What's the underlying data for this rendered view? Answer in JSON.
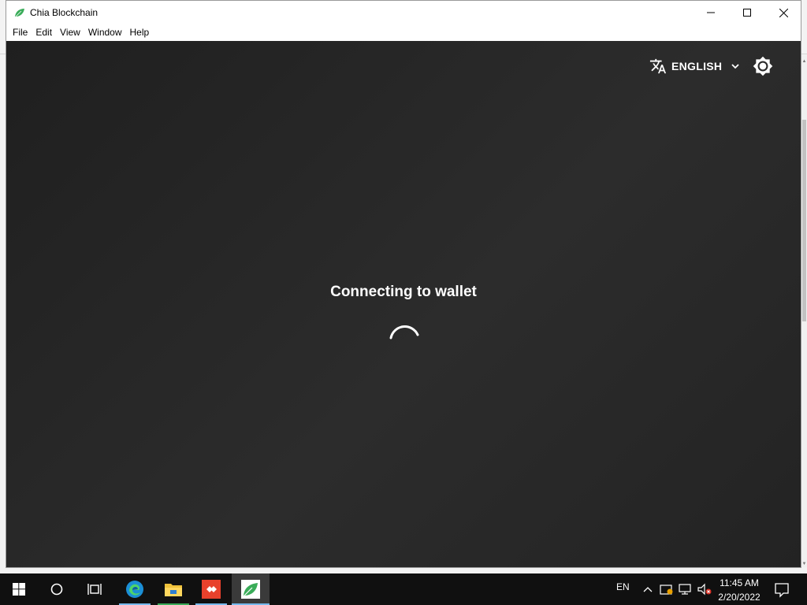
{
  "window": {
    "title": "Chia Blockchain"
  },
  "menubar": {
    "items": [
      "File",
      "Edit",
      "View",
      "Window",
      "Help"
    ]
  },
  "header": {
    "language_label": "ENGLISH"
  },
  "main": {
    "status_text": "Connecting to wallet"
  },
  "taskbar": {
    "input_language": "EN",
    "time": "11:45 AM",
    "date": "2/20/2022"
  },
  "colors": {
    "content_bg": "#252525",
    "taskbar_bg": "#101010",
    "chia_green": "#3aac59",
    "text_white": "#ffffff"
  },
  "icons": {
    "app": "chia-leaf-icon",
    "language": "translate-icon",
    "chevron": "chevron-down-icon",
    "theme": "brightness-icon",
    "spinner": "loading-spinner-icon"
  }
}
